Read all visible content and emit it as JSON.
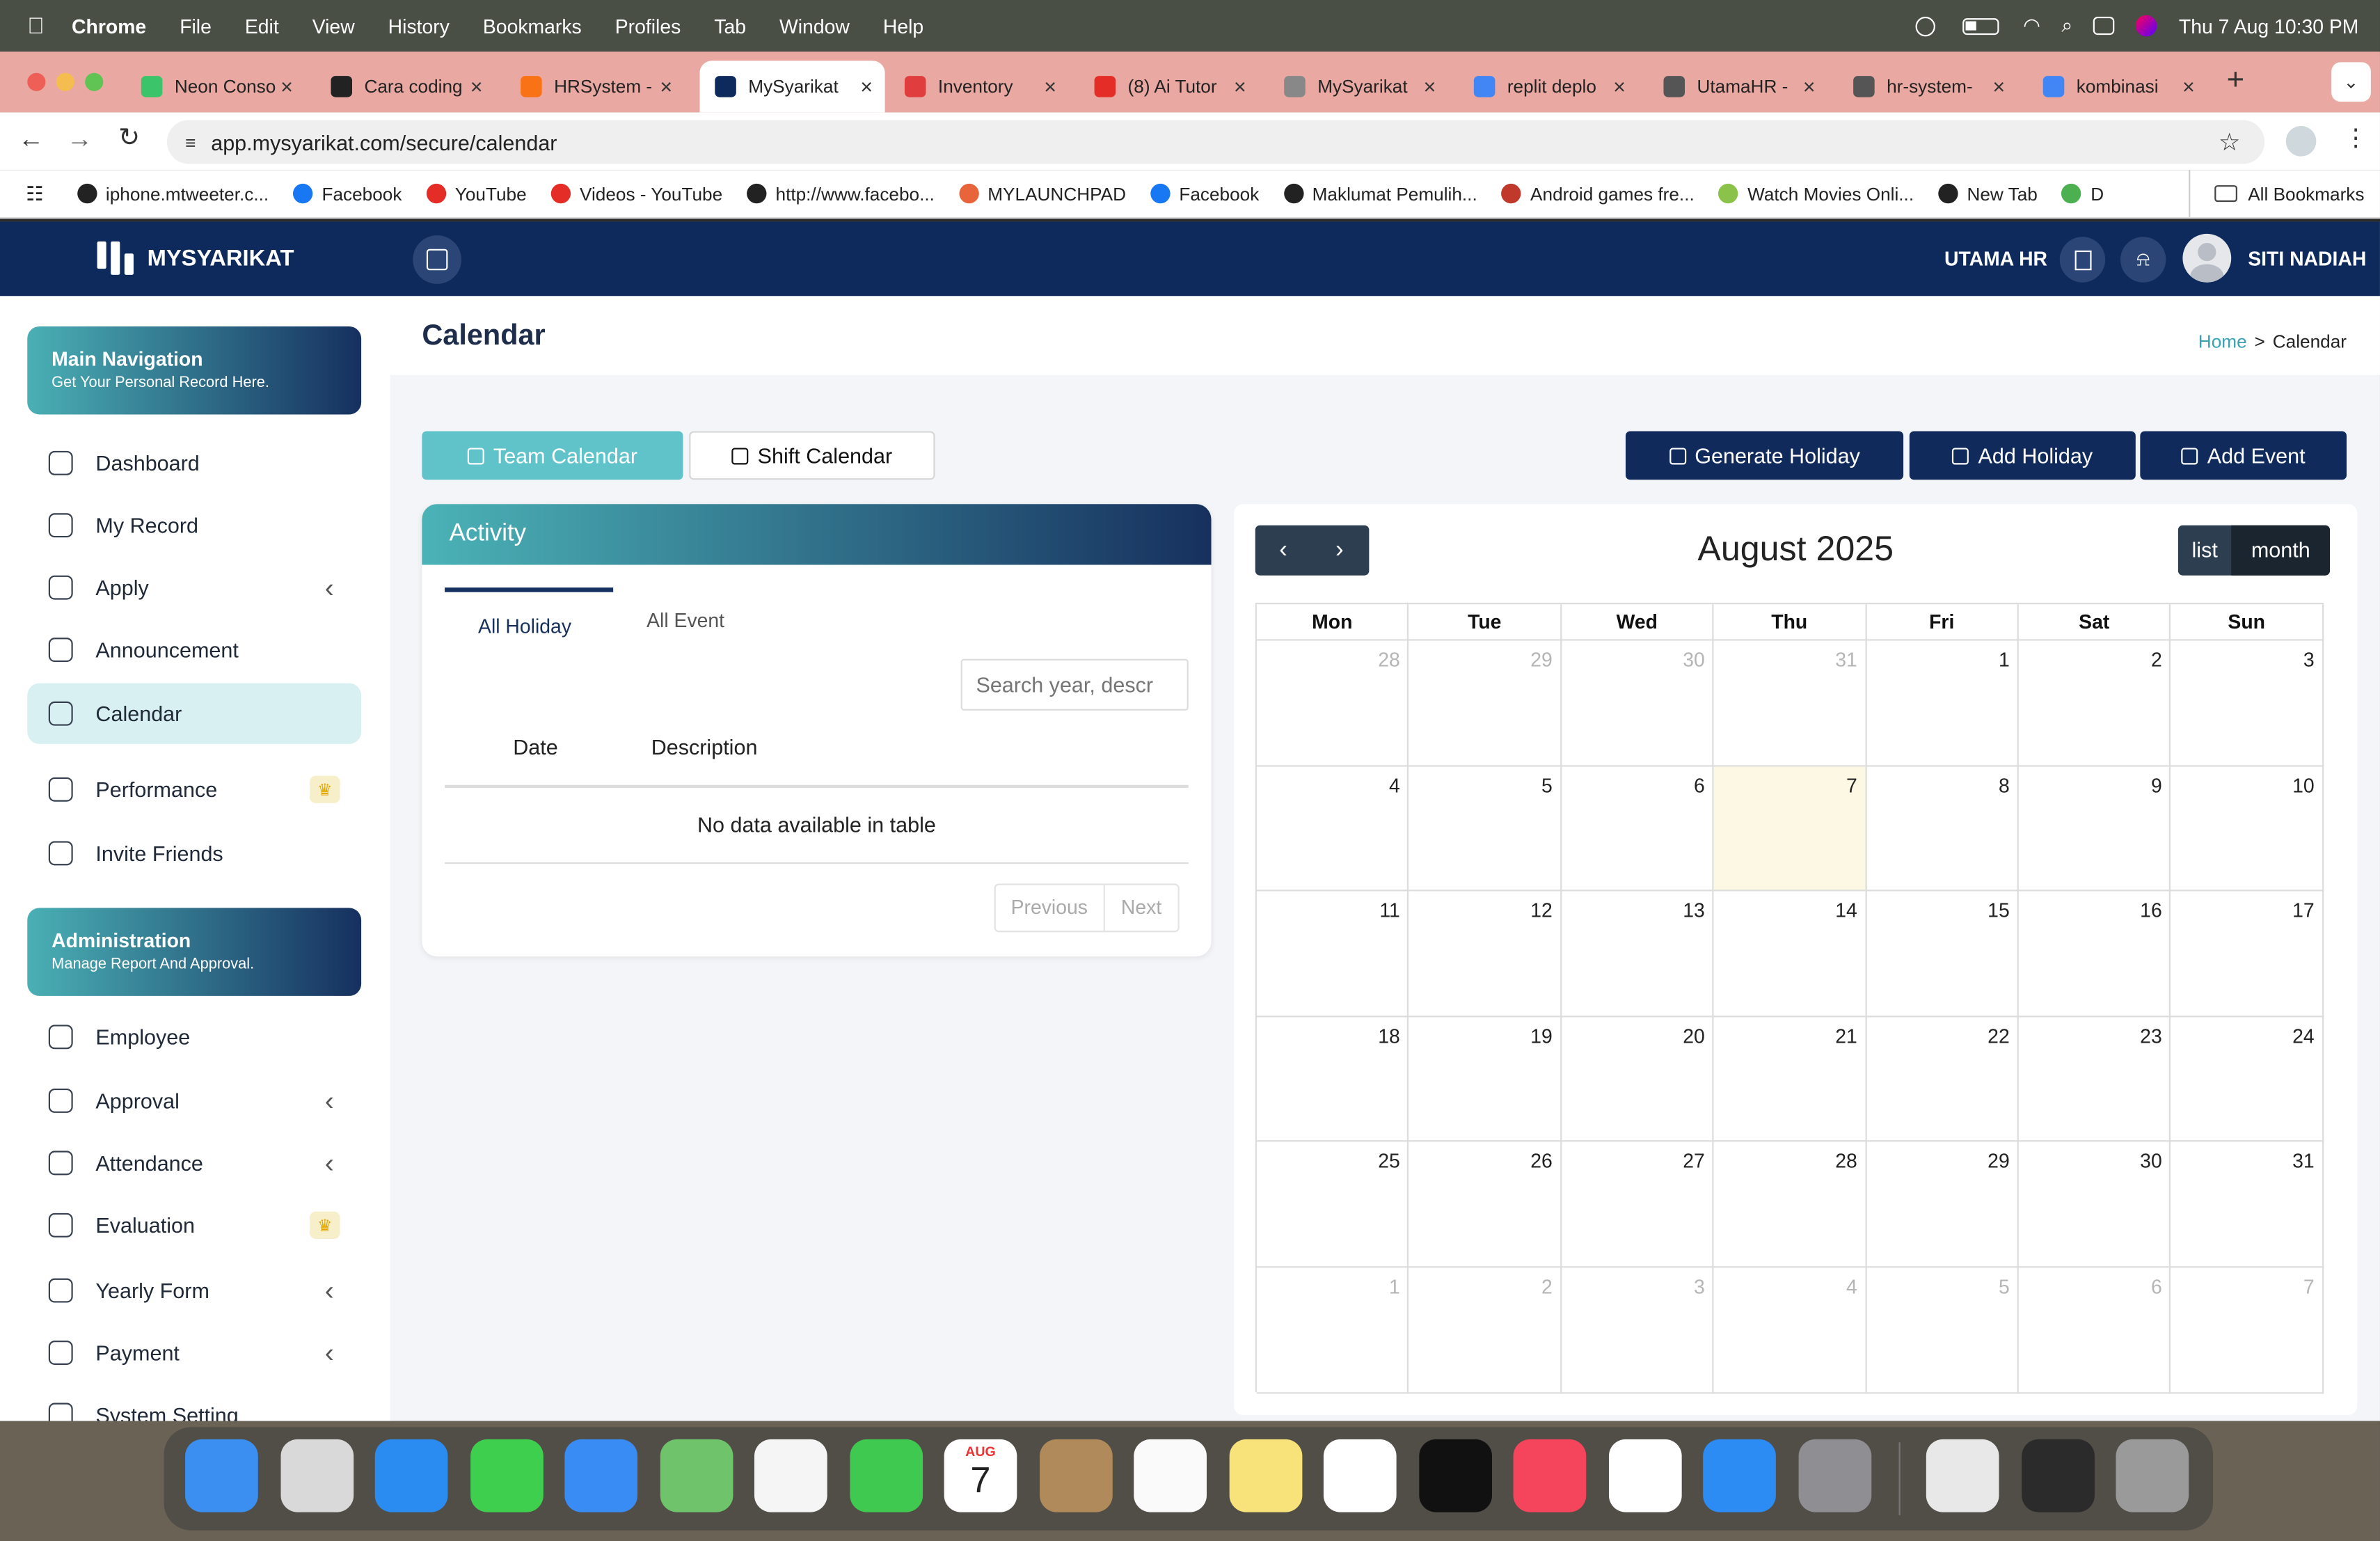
{
  "menubar": {
    "app": "Chrome",
    "items": [
      "File",
      "Edit",
      "View",
      "History",
      "Bookmarks",
      "Profiles",
      "Tab",
      "Window",
      "Help"
    ],
    "datetime": "Thu 7 Aug  10:30 PM"
  },
  "tabs": [
    {
      "title": "Neon Conso",
      "color": "#3cc46a"
    },
    {
      "title": "Cara coding",
      "color": "#222"
    },
    {
      "title": "HRSystem -",
      "color": "#f97316"
    },
    {
      "title": "MySyarikat",
      "color": "#0e2a5c"
    },
    {
      "title": "Inventory",
      "color": "#e03e3e"
    },
    {
      "title": "(8) Ai Tutor",
      "color": "#e52d27"
    },
    {
      "title": "MySyarikat",
      "color": "#888"
    },
    {
      "title": "replit deplo",
      "color": "#4285f4"
    },
    {
      "title": "UtamaHR -",
      "color": "#555"
    },
    {
      "title": "hr-system-",
      "color": "#555"
    },
    {
      "title": "kombinasi",
      "color": "#4285f4"
    }
  ],
  "url": "app.mysyarikat.com/secure/calendar",
  "bookmarks": [
    {
      "label": "iphone.mtweeter.c...",
      "color": "#222"
    },
    {
      "label": "Facebook",
      "color": "#1877f2"
    },
    {
      "label": "YouTube",
      "color": "#e52d27"
    },
    {
      "label": "Videos - YouTube",
      "color": "#e52d27"
    },
    {
      "label": "http://www.facebo...",
      "color": "#222"
    },
    {
      "label": "MYLAUNCHPAD",
      "color": "#e8643b"
    },
    {
      "label": "Facebook",
      "color": "#1877f2"
    },
    {
      "label": "Maklumat Pemulih...",
      "color": "#222"
    },
    {
      "label": "Android games fre...",
      "color": "#c0392b"
    },
    {
      "label": "Watch Movies Onli...",
      "color": "#8bc34a"
    },
    {
      "label": "New Tab",
      "color": "#222"
    },
    {
      "label": "D",
      "color": "#4caf50"
    }
  ],
  "all_bookmarks": "All Bookmarks",
  "brand": "MYSYARIKAT",
  "header": {
    "company": "UTAMA HR",
    "user": "SITI NADIAH"
  },
  "sidebar": {
    "main_card": {
      "title": "Main Navigation",
      "subtitle": "Get Your Personal Record Here."
    },
    "main_items": [
      {
        "label": "Dashboard",
        "chevron": false,
        "crown": false
      },
      {
        "label": "My Record",
        "chevron": false,
        "crown": false
      },
      {
        "label": "Apply",
        "chevron": true,
        "crown": false
      },
      {
        "label": "Announcement",
        "chevron": false,
        "crown": false
      },
      {
        "label": "Calendar",
        "chevron": false,
        "crown": false,
        "active": true
      },
      {
        "label": "Performance",
        "chevron": false,
        "crown": true
      },
      {
        "label": "Invite Friends",
        "chevron": false,
        "crown": false
      }
    ],
    "admin_card": {
      "title": "Administration",
      "subtitle": "Manage Report And Approval."
    },
    "admin_items": [
      {
        "label": "Employee",
        "chevron": false,
        "crown": false
      },
      {
        "label": "Approval",
        "chevron": true,
        "crown": false
      },
      {
        "label": "Attendance",
        "chevron": true,
        "crown": false
      },
      {
        "label": "Evaluation",
        "chevron": false,
        "crown": true
      },
      {
        "label": "Yearly Form",
        "chevron": true,
        "crown": false
      },
      {
        "label": "Payment",
        "chevron": true,
        "crown": false
      },
      {
        "label": "System Setting",
        "chevron": false,
        "crown": false
      }
    ]
  },
  "page": {
    "title": "Calendar",
    "breadcrumb_home": "Home",
    "breadcrumb_sep": ">",
    "breadcrumb_current": "Calendar"
  },
  "buttons": {
    "team_calendar": "Team Calendar",
    "shift_calendar": "Shift Calendar",
    "generate_holiday": "Generate Holiday",
    "add_holiday": "Add Holiday",
    "add_event": "Add Event"
  },
  "activity": {
    "title": "Activity",
    "tab_holiday": "All Holiday",
    "tab_event": "All Event",
    "search_placeholder": "Search year, descr",
    "col_date": "Date",
    "col_description": "Description",
    "empty": "No data available in table",
    "previous": "Previous",
    "next": "Next"
  },
  "calendar": {
    "title": "August 2025",
    "view_list": "list",
    "view_month": "month",
    "weekdays": [
      "Mon",
      "Tue",
      "Wed",
      "Thu",
      "Fri",
      "Sat",
      "Sun"
    ],
    "weeks": [
      [
        {
          "d": "28",
          "o": true
        },
        {
          "d": "29",
          "o": true
        },
        {
          "d": "30",
          "o": true
        },
        {
          "d": "31",
          "o": true
        },
        {
          "d": "1"
        },
        {
          "d": "2"
        },
        {
          "d": "3"
        }
      ],
      [
        {
          "d": "4"
        },
        {
          "d": "5"
        },
        {
          "d": "6"
        },
        {
          "d": "7",
          "today": true
        },
        {
          "d": "8"
        },
        {
          "d": "9"
        },
        {
          "d": "10"
        }
      ],
      [
        {
          "d": "11"
        },
        {
          "d": "12"
        },
        {
          "d": "13"
        },
        {
          "d": "14"
        },
        {
          "d": "15"
        },
        {
          "d": "16"
        },
        {
          "d": "17"
        }
      ],
      [
        {
          "d": "18"
        },
        {
          "d": "19"
        },
        {
          "d": "20"
        },
        {
          "d": "21"
        },
        {
          "d": "22"
        },
        {
          "d": "23"
        },
        {
          "d": "24"
        }
      ],
      [
        {
          "d": "25"
        },
        {
          "d": "26"
        },
        {
          "d": "27"
        },
        {
          "d": "28"
        },
        {
          "d": "29"
        },
        {
          "d": "30"
        },
        {
          "d": "31"
        }
      ],
      [
        {
          "d": "1",
          "o": true
        },
        {
          "d": "2",
          "o": true
        },
        {
          "d": "3",
          "o": true
        },
        {
          "d": "4",
          "o": true
        },
        {
          "d": "5",
          "o": true
        },
        {
          "d": "6",
          "o": true
        },
        {
          "d": "7",
          "o": true
        }
      ]
    ]
  },
  "dock": {
    "calendar_month": "AUG",
    "calendar_day": "7",
    "apps": [
      {
        "name": "finder",
        "color": "#3b8ff0"
      },
      {
        "name": "launchpad",
        "color": "#d9d9d9"
      },
      {
        "name": "safari",
        "color": "#2a8cf0"
      },
      {
        "name": "messages",
        "color": "#3fcf4f"
      },
      {
        "name": "mail",
        "color": "#3a8cf5"
      },
      {
        "name": "maps",
        "color": "#6ec36b"
      },
      {
        "name": "photos",
        "color": "#f5f5f5"
      },
      {
        "name": "facetime",
        "color": "#3fc950"
      },
      {
        "name": "calendar",
        "color": "#ffffff"
      },
      {
        "name": "contacts",
        "color": "#b08a5a"
      },
      {
        "name": "reminders",
        "color": "#fafafa"
      },
      {
        "name": "notes",
        "color": "#f8e27a"
      },
      {
        "name": "freeform",
        "color": "#ffffff"
      },
      {
        "name": "tv",
        "color": "#111111"
      },
      {
        "name": "music",
        "color": "#f5455c"
      },
      {
        "name": "chrome",
        "color": "#ffffff"
      },
      {
        "name": "app-store",
        "color": "#2c8cf4"
      },
      {
        "name": "system-settings",
        "color": "#8e8e93"
      },
      {
        "name": "preview",
        "color": "#e8e8e8"
      },
      {
        "name": "screen-thumbnail",
        "color": "#2b2b2b"
      },
      {
        "name": "trash",
        "color": "#9a9a9a"
      }
    ]
  }
}
